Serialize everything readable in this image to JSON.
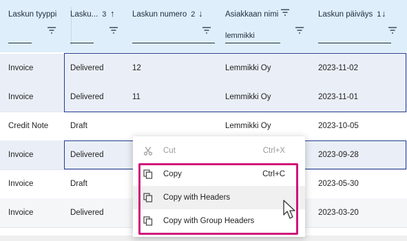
{
  "columns": [
    {
      "title": "Laskun tyyppi",
      "sort_index": "",
      "sort_dir": "",
      "filter_value": ""
    },
    {
      "title": "Lasku...",
      "sort_index": "3",
      "sort_dir": "↑",
      "filter_value": ""
    },
    {
      "title": "Laskun numero",
      "sort_index": "2",
      "sort_dir": "↓",
      "filter_value": ""
    },
    {
      "title": "Asiakkaan nimi",
      "sort_index": "",
      "sort_dir": "",
      "filter_value": "lemmikki"
    },
    {
      "title": "Laskun päiväys",
      "sort_index": "1",
      "sort_dir": "↓",
      "filter_value": ""
    }
  ],
  "rows": [
    [
      "Invoice",
      "Delivered",
      "12",
      "Lemmikki Oy",
      "2023-11-02"
    ],
    [
      "Invoice",
      "Delivered",
      "11",
      "Lemmikki Oy",
      "2023-11-01"
    ],
    [
      "Credit Note",
      "Draft",
      "",
      "Lemmikki Oy",
      "2023-10-05"
    ],
    [
      "Invoice",
      "Delivered",
      "",
      "",
      "2023-09-28"
    ],
    [
      "Invoice",
      "Draft",
      "",
      "",
      "2023-05-30"
    ],
    [
      "Invoice",
      "Delivered",
      "",
      "",
      "2023-03-20"
    ]
  ],
  "context_menu": {
    "items": [
      {
        "label": "Cut",
        "shortcut": "Ctrl+X",
        "icon": "scissors-icon",
        "disabled": true
      },
      {
        "label": "Copy",
        "shortcut": "Ctrl+C",
        "icon": "copy-icon",
        "disabled": false
      },
      {
        "label": "Copy with Headers",
        "shortcut": "",
        "icon": "copy-icon",
        "disabled": false
      },
      {
        "label": "Copy with Group Headers",
        "shortcut": "",
        "icon": "copy-icon",
        "disabled": false
      }
    ]
  },
  "colors": {
    "header_bg": "#dfeefb",
    "selection_border": "#1f3b8f",
    "highlight": "#d0137a"
  }
}
